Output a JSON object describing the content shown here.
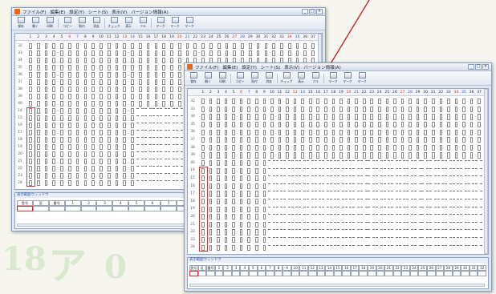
{
  "menu": [
    {
      "label": "ファイル(F)"
    },
    {
      "label": "編集(E)"
    },
    {
      "label": "設定(Y)"
    },
    {
      "label": "シート(S)"
    },
    {
      "label": "表示(V)"
    },
    {
      "label": "バージョン情報(A)"
    }
  ],
  "toolbar": [
    {
      "label": "保存"
    },
    {
      "label": "開く"
    },
    {
      "label": "印刷"
    },
    {
      "label": "コピー"
    },
    {
      "label": "貼付"
    },
    {
      "label": "消去"
    },
    {
      "label": "チェック"
    },
    {
      "label": "表示"
    },
    {
      "label": "フル"
    },
    {
      "label": "マーク"
    },
    {
      "label": "マーク"
    },
    {
      "label": "マーク"
    }
  ],
  "columns": [
    "1",
    "2",
    "3",
    "4",
    "5",
    "6",
    "7",
    "8",
    "9",
    "10",
    "11",
    "12",
    "13",
    "14",
    "15",
    "16",
    "17",
    "18",
    "19",
    "20",
    "21",
    "22",
    "23",
    "24",
    "25",
    "26",
    "27",
    "28",
    "29",
    "30",
    "31",
    "32",
    "33",
    "34",
    "35",
    "36",
    "37"
  ],
  "rows": [
    "32",
    "33",
    "34",
    "35",
    "36",
    "37",
    "38",
    "39",
    "40",
    "14",
    "15",
    "16",
    "17",
    "18",
    "19",
    "20",
    "21",
    "22",
    "23",
    "24"
  ],
  "panel_title": "表示範囲ウィンドウ",
  "panel_headers": [
    "受号",
    "区",
    "番号"
  ],
  "panel_nums": [
    "1",
    "2",
    "3",
    "4",
    "5",
    "6",
    "7",
    "8",
    "9",
    "10",
    "11",
    "12",
    "13",
    "14",
    "15",
    "16",
    "17",
    "18",
    "19",
    "20",
    "21",
    "22",
    "23",
    "24",
    "25",
    "26",
    "27",
    "28",
    "29",
    "30",
    "31",
    "32"
  ],
  "colors": {
    "accent": "#d0342c",
    "header_blue": "#2f5fc4",
    "window_blue": "#8aa0bc"
  }
}
